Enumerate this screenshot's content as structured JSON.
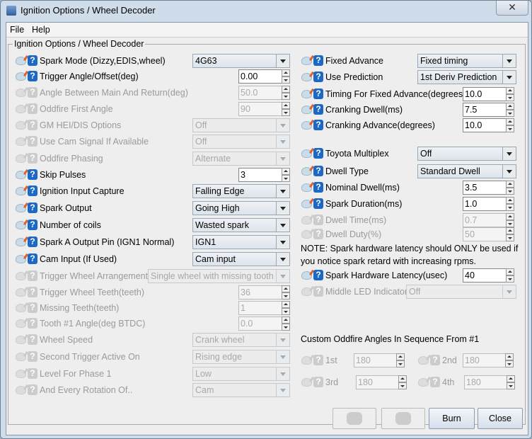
{
  "window": {
    "title": "Ignition Options / Wheel Decoder",
    "close": "✕"
  },
  "menu": [
    {
      "label": "File",
      "mnemonic": "F"
    },
    {
      "label": "Help",
      "mnemonic": "H"
    }
  ],
  "group_title": "Ignition Options / Wheel Decoder",
  "left": [
    {
      "label": "Spark Mode (Dizzy,EDIS,wheel)",
      "type": "combo",
      "value": "4G63",
      "enabled": true
    },
    {
      "label": "Trigger Angle/Offset(deg)",
      "type": "spin",
      "value": "0.00",
      "enabled": true
    },
    {
      "label": "Angle Between Main And Return(deg)",
      "type": "spin",
      "value": "50.0",
      "enabled": false
    },
    {
      "label": "Oddfire First Angle",
      "type": "spin",
      "value": "90",
      "enabled": false
    },
    {
      "label": "GM HEI/DIS Options",
      "type": "combo",
      "value": "Off",
      "enabled": false
    },
    {
      "label": "Use Cam Signal If Available",
      "type": "combo",
      "value": "Off",
      "enabled": false
    },
    {
      "label": "Oddfire Phasing",
      "type": "combo",
      "value": "Alternate",
      "enabled": false
    },
    {
      "label": "Skip Pulses",
      "type": "spin",
      "value": "3",
      "enabled": true
    },
    {
      "label": "Ignition Input Capture",
      "type": "combo",
      "value": "Falling Edge",
      "enabled": true
    },
    {
      "label": "Spark Output",
      "type": "combo",
      "value": "Going High",
      "enabled": true
    },
    {
      "label": "Number of coils",
      "type": "combo",
      "value": "Wasted spark",
      "enabled": true
    },
    {
      "label": "Spark A Output Pin (IGN1 Normal)",
      "type": "combo",
      "value": "IGN1",
      "enabled": true
    },
    {
      "label": "Cam Input (If Used)",
      "type": "combo",
      "value": "Cam input",
      "enabled": true
    },
    {
      "label": "Trigger Wheel Arrangement",
      "type": "widecombo",
      "value": "Single wheel with missing tooth",
      "enabled": false
    },
    {
      "label": "Trigger Wheel Teeth(teeth)",
      "type": "spin",
      "value": "36",
      "enabled": false
    },
    {
      "label": "Missing Teeth(teeth)",
      "type": "spin",
      "value": "1",
      "enabled": false
    },
    {
      "label": "Tooth #1 Angle(deg BTDC)",
      "type": "spin",
      "value": "0.0",
      "enabled": false
    },
    {
      "label": "Wheel Speed",
      "type": "combo",
      "value": "Crank wheel",
      "enabled": false
    },
    {
      "label": "Second Trigger Active On",
      "type": "combo",
      "value": "Rising edge",
      "enabled": false
    },
    {
      "label": "Level For Phase 1",
      "type": "combo",
      "value": "Low",
      "enabled": false
    },
    {
      "label": "And Every Rotation Of..",
      "type": "combo",
      "value": "Cam",
      "enabled": false
    }
  ],
  "right": [
    {
      "label": "Fixed Advance",
      "type": "combo",
      "value": "Fixed timing",
      "enabled": true
    },
    {
      "label": "Use Prediction",
      "type": "combo",
      "value": "1st Deriv Prediction",
      "enabled": true
    },
    {
      "label": "Timing For Fixed Advance(degrees)",
      "type": "spin",
      "value": "10.0",
      "enabled": true
    },
    {
      "label": "Cranking Dwell(ms)",
      "type": "spin",
      "value": "7.5",
      "enabled": true
    },
    {
      "label": "Cranking Advance(degrees)",
      "type": "spin",
      "value": "10.0",
      "enabled": true
    },
    {
      "label": "Toyota Multiplex",
      "type": "combo",
      "value": "Off",
      "enabled": true
    },
    {
      "label": "Dwell Type",
      "type": "combo",
      "value": "Standard Dwell",
      "enabled": true
    },
    {
      "label": "Nominal Dwell(ms)",
      "type": "spin",
      "value": "3.5",
      "enabled": true
    },
    {
      "label": "Spark Duration(ms)",
      "type": "spin",
      "value": "1.0",
      "enabled": true
    },
    {
      "label": "Dwell Time(ms)",
      "type": "spin",
      "value": "0.7",
      "enabled": false
    },
    {
      "label": "Dwell Duty(%)",
      "type": "spin",
      "value": "50",
      "enabled": false
    },
    {
      "label": "Spark Hardware Latency(usec)",
      "type": "spin",
      "value": "40",
      "enabled": true
    },
    {
      "label": "Middle LED Indicator",
      "type": "widecombo",
      "value": "Off",
      "enabled": false
    }
  ],
  "note": [
    "NOTE: Spark hardware latency should ONLY be used if",
    "you notice spark retard with increasing rpms."
  ],
  "oddfire": {
    "title": "Custom Oddfire Angles In Sequence From #1",
    "items": [
      {
        "label": "1st",
        "value": "180"
      },
      {
        "label": "2nd",
        "value": "180"
      },
      {
        "label": "3rd",
        "value": "180"
      },
      {
        "label": "4th",
        "value": "180"
      }
    ]
  },
  "buttons": {
    "burn": "Burn",
    "close": "Close"
  }
}
